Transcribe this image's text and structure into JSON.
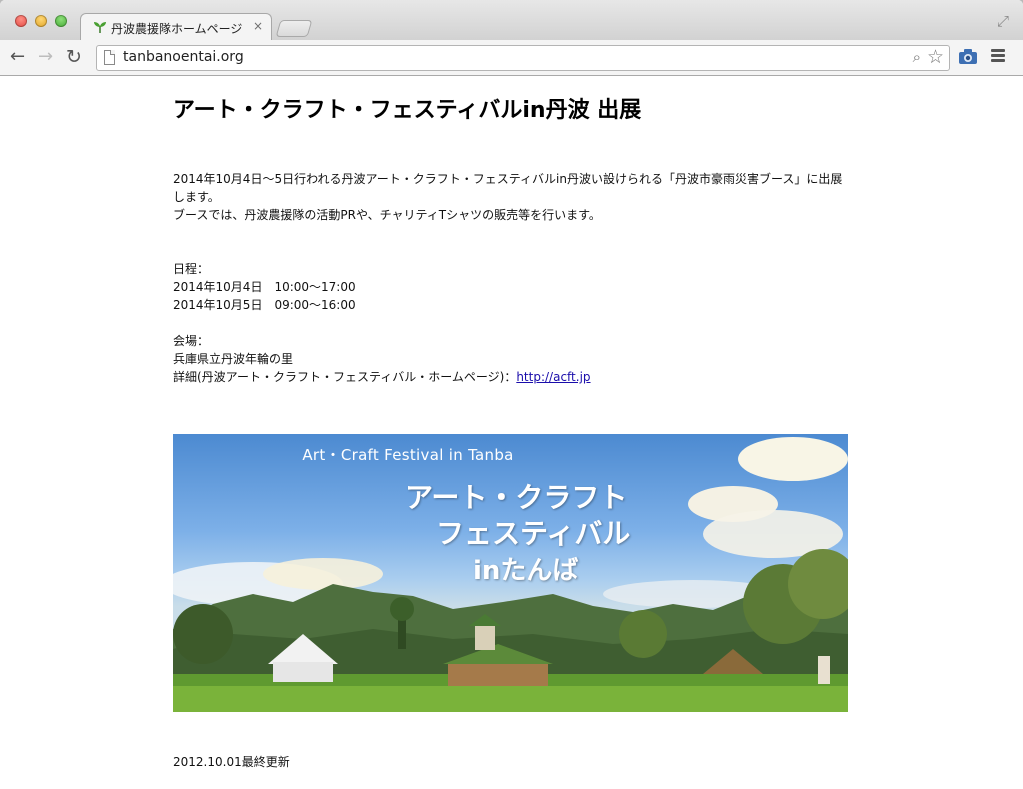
{
  "browser": {
    "tab_title": "丹波農援隊ホームページ",
    "tab_close": "×",
    "url": "tanbanoentai.org"
  },
  "article": {
    "title": "アート・クラフト・フェスティバルin丹波 出展",
    "intro": "2014年10月4日〜5日行われる丹波アート・クラフト・フェスティバルin丹波い設けられる「丹波市豪雨災害ブース」に出展します。",
    "booth": "ブースでは、丹波農援隊の活動PRや、チャリティTシャツの販売等を行います。",
    "schedule_label": "日程：",
    "schedule": [
      "2014年10月4日　10:00〜17:00",
      "2014年10月5日　09:00〜16:00"
    ],
    "venue_label": "会場：",
    "venue": "兵庫県立丹波年輪の里",
    "details_prefix": "詳細(丹波アート・クラフト・フェスティバル・ホームページ)：",
    "details_link": "http://acft.jp"
  },
  "banner": {
    "english_title": "Art・Craft Festival in Tanba",
    "japanese_line1": "アート・クラフト",
    "japanese_line2": "フェスティバル",
    "japanese_line3": "inたんば"
  },
  "footer": {
    "updated": "2012.10.01最終更新"
  }
}
